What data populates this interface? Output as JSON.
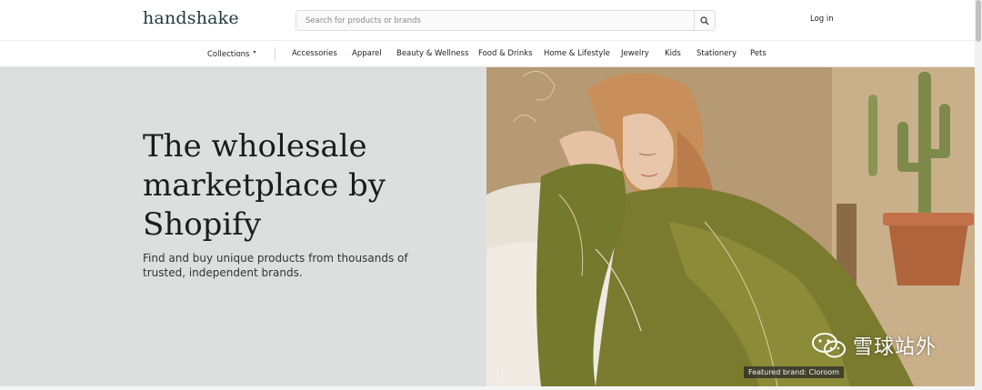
{
  "header": {
    "logo": "handshake",
    "search": {
      "placeholder": "Search for products or brands"
    },
    "login_label": "Log in"
  },
  "nav": {
    "collections_label": "Collections",
    "items": [
      {
        "label": "Accessories"
      },
      {
        "label": "Apparel"
      },
      {
        "label": "Beauty & Wellness"
      },
      {
        "label": "Food & Drinks"
      },
      {
        "label": "Home & Lifestyle"
      },
      {
        "label": "Jewelry"
      },
      {
        "label": "Kids"
      },
      {
        "label": "Stationery"
      },
      {
        "label": "Pets"
      }
    ]
  },
  "hero": {
    "title": "The wholesale marketplace by Shopify",
    "subtitle": "Find and buy unique products from thousands of trusted, independent brands.",
    "featured_caption": "Featured brand: Cloroom",
    "watermark_text": "雪球站外"
  },
  "colors": {
    "brand_green": "#1f3a35",
    "hero_bg": "#dbe0de",
    "silk_green": "#7a7a2e"
  },
  "icons": {
    "search": "search-icon",
    "pause": "pause-icon",
    "wechat": "wechat-icon",
    "dropdown": "chevron-down-icon"
  }
}
